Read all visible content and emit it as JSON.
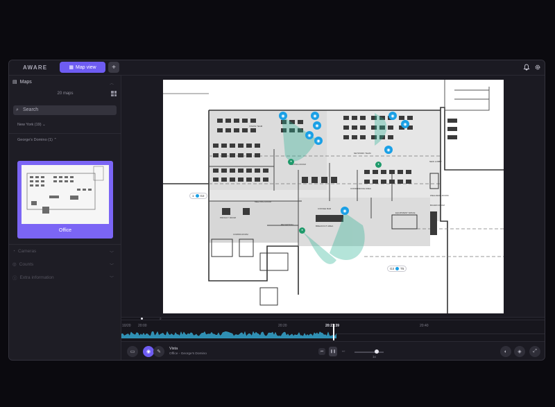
{
  "app": {
    "logo": "AWARE",
    "active_tab": "Map view",
    "add_tab": "+",
    "accent_color": "#6e5cf2"
  },
  "topbar_icons": [
    "bell-icon",
    "gear-icon"
  ],
  "sidebar": {
    "header": "Maps",
    "map_count": "20 maps",
    "search_placeholder": "Search",
    "region_filter": "New York (19)",
    "building_filter": "George's Domino (1)",
    "card_label": "Office",
    "sections": [
      "Cameras",
      "Counts",
      "Extra information"
    ]
  },
  "map": {
    "room_labels": [
      "VISION TEAM",
      "MEETING ROOM",
      "MEETING ROOM",
      "NETWORK TEAM",
      "NEW LOBBY",
      "CONFERENCE AREA",
      "WELLNESS ROOM",
      "EQUIPMENT SPACE",
      "PRIVACY ROOM",
      "COMMS ROOM",
      "RECEPTION",
      "BREAKOUT AREA",
      "COFFEE BAR",
      "BOARD ROOM"
    ],
    "pills": [
      {
        "left": "1",
        "right": "G2"
      },
      {
        "left": "G3",
        "right": "T5"
      }
    ]
  },
  "timeline": {
    "ticks": [
      "10/20",
      "20:00",
      "20:20",
      "20:21:39",
      "20:40"
    ],
    "now": "20:21:39"
  },
  "bottombar": {
    "view_title": "Vista",
    "view_subtitle": "Office - George's Domino",
    "speed": "1x"
  }
}
